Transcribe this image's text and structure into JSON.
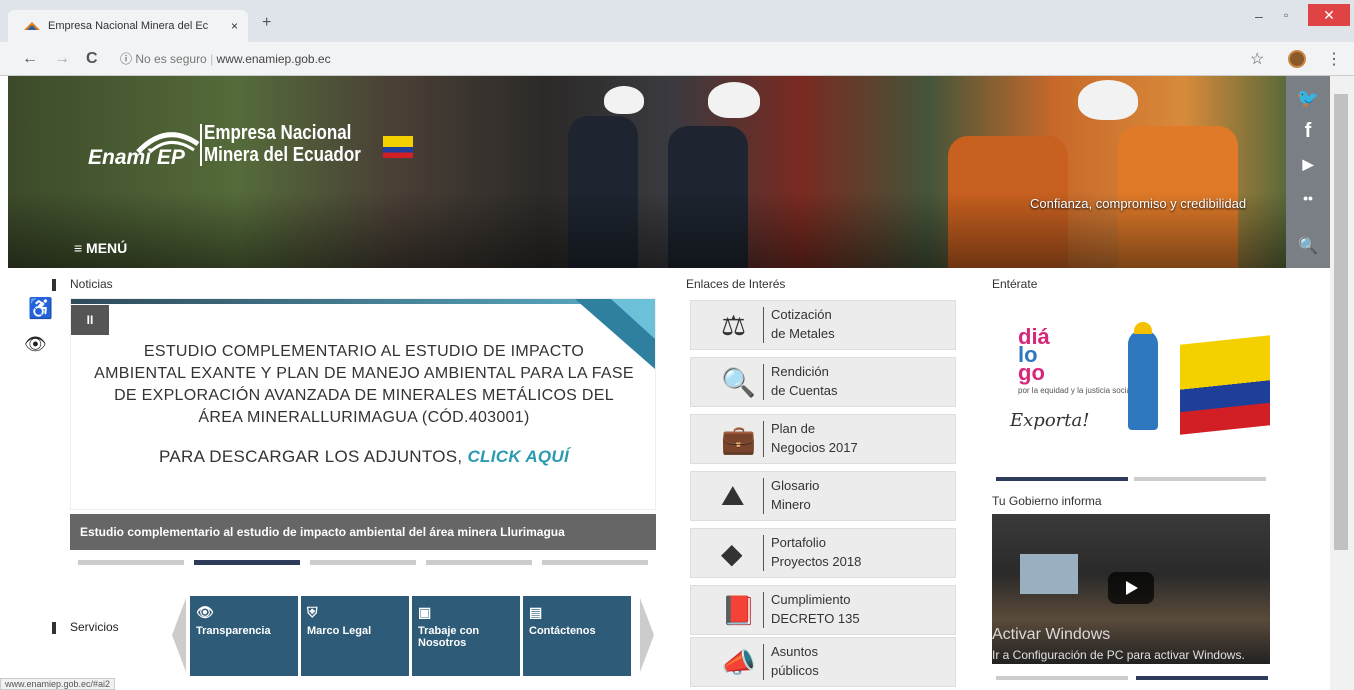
{
  "browser": {
    "tab_title": "Empresa Nacional Minera del Ec",
    "tab_close": "×",
    "new_tab": "+",
    "back": "←",
    "forward": "→",
    "reload": "C",
    "security_icon": "ⓘ",
    "not_secure": "No es seguro",
    "url": "www.enamiep.gob.ec",
    "star": "☆",
    "kebab": "⋮",
    "win_min": "–",
    "win_max": "▫",
    "win_close": "✕"
  },
  "header": {
    "brand": "Enami EP",
    "name_line1": "Empresa Nacional",
    "name_line2": "Minera del Ecuador",
    "slogan": "Confianza, compromiso y credibilidad",
    "menu_label": "≡ MENÚ"
  },
  "social": [
    {
      "icon": "twitter-icon",
      "glyph": "🐦"
    },
    {
      "icon": "facebook-icon",
      "glyph": "f"
    },
    {
      "icon": "youtube-icon",
      "glyph": "▶"
    },
    {
      "icon": "flickr-icon",
      "glyph": "••"
    },
    {
      "icon": "search-icon",
      "glyph": "🔍"
    }
  ],
  "accessibility": {
    "person_icon": "♿",
    "eye_icon": "👁"
  },
  "noticias": {
    "heading": "Noticias",
    "pause": "II",
    "slide_line1": "ESTUDIO COMPLEMENTARIO AL ESTUDIO DE IMPACTO",
    "slide_line2": "AMBIENTAL EXANTE Y PLAN DE MANEJO AMBIENTAL PARA LA FASE",
    "slide_line3": "DE EXPLORACIÓN AVANZADA DE MINERALES METÁLICOS DEL",
    "slide_line4": "ÁREA MINERALLURIMAGUA (CÓD.403001)",
    "cta_text": "PARA DESCARGAR LOS ADJUNTOS,",
    "cta_link": "CLICK AQUÍ",
    "caption": "Estudio complementario al estudio de impacto ambiental del área minera Llurimagua",
    "active_dot": 2
  },
  "servicios": {
    "heading": "Servicios",
    "items": [
      {
        "label": "Transparencia",
        "icon": "eye-icon",
        "glyph": "👁"
      },
      {
        "label": "Marco Legal",
        "icon": "shield-icon",
        "glyph": "⛨"
      },
      {
        "label": "Trabaje con Nosotros",
        "icon": "id-card-icon",
        "glyph": "▣"
      },
      {
        "label": "Contáctenos",
        "icon": "contact-card-icon",
        "glyph": "▤"
      }
    ]
  },
  "enlaces": {
    "heading": "Enlaces de Interés",
    "items": [
      {
        "l1": "Cotización",
        "l2": "de Metales",
        "icon": "scale-icon",
        "glyph": "⚖"
      },
      {
        "l1": "Rendición",
        "l2": "de Cuentas",
        "icon": "magnifier-icon",
        "glyph": "🔍"
      },
      {
        "l1": "Plan de",
        "l2": "Negocios 2017",
        "icon": "briefcase-icon",
        "glyph": "💼"
      },
      {
        "l1": "Glosario",
        "l2": "Minero",
        "icon": "mountain-icon",
        "glyph": "⛰"
      },
      {
        "l1": "Portafolio",
        "l2": "Proyectos 2018",
        "icon": "ecuador-map-icon",
        "glyph": "◆"
      },
      {
        "l1": "Cumplimiento",
        "l2": "DECRETO 135",
        "icon": "book-icon",
        "glyph": "📕"
      },
      {
        "l1": "Asuntos",
        "l2": "públicos",
        "icon": "megaphone-icon",
        "glyph": "📣"
      }
    ]
  },
  "enterate": {
    "heading": "Entérate",
    "dialogo_line1": "diá",
    "dialogo_line2": "lo",
    "dialogo_line3": "go",
    "dialogo_sub": "por la equidad y la justicia social",
    "exporta": "Exporta!",
    "gobierno_title": "Tu Gobierno informa",
    "watermark1": "Activar Windows",
    "watermark2": "Ir a Configuración de PC para activar Windows."
  },
  "status_url": "www.enamiep.gob.ec/#ai2"
}
